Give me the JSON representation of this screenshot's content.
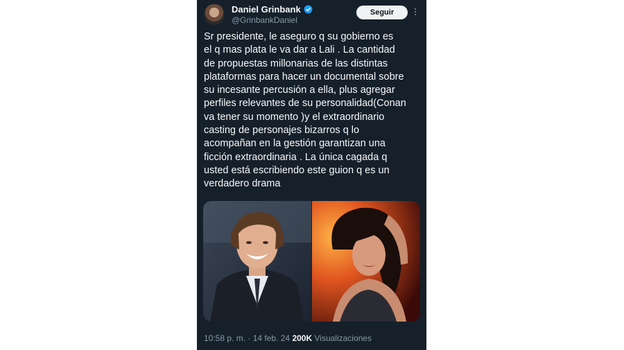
{
  "tweet": {
    "author_name": "Daniel Grinbank",
    "author_handle": "@GrinbankDaniel",
    "verified": true,
    "follow_label": "Seguir",
    "text": "Sr presidente, le aseguro q su gobierno es\nel q mas plata le va dar a Lali . La cantidad\nde propuestas millonarias de las distintas\nplataformas para hacer un documental sobre\nsu incesante percusión a ella, plus agregar\nperfiles relevantes de su personalidad(Conan\nva tener su momento )y el extraordinario\ncasting de personajes bizarros q lo\nacompañan en la gestión garantizan una\nficción extraordinaria . La única cagada q\nusted está escribiendo este guion q es un\nverdadero drama",
    "time": "10:58 p. m.",
    "separator": " · ",
    "date": "14 feb. 24",
    "views_count": "200K",
    "views_label": "Visualizaciones"
  },
  "icons": {
    "avatar": "avatar",
    "verified": "verified-badge-icon",
    "more": "more-options-icon"
  },
  "colors": {
    "background": "#15202b",
    "text": "#f5f8fa",
    "secondary_text": "#8b98a5",
    "verified_blue": "#1d9bf0",
    "button_bg": "#eff3f4"
  }
}
